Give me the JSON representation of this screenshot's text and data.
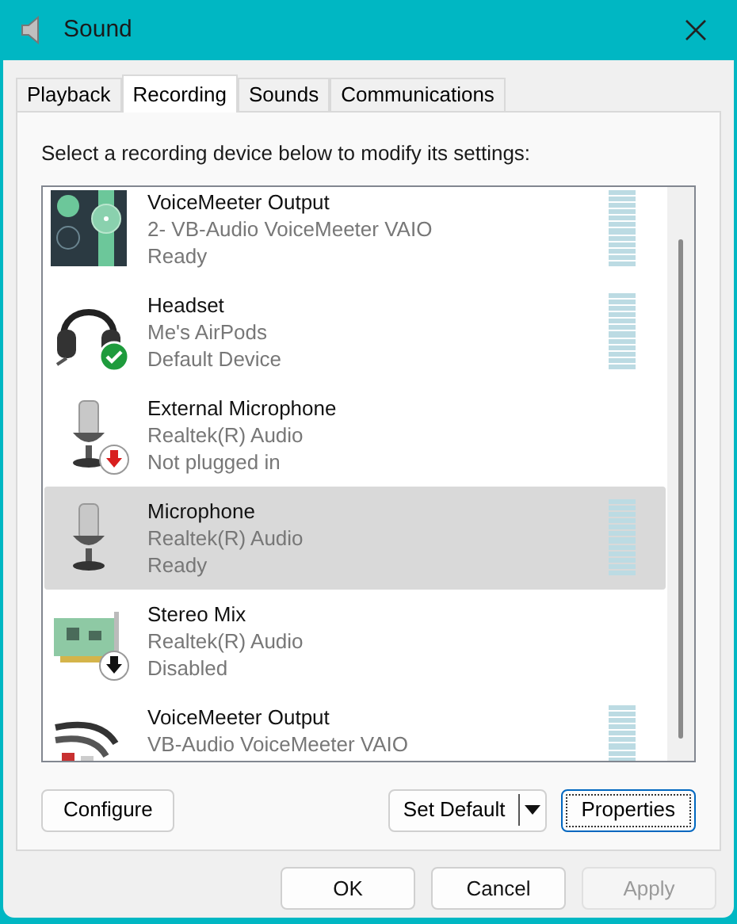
{
  "window": {
    "title": "Sound"
  },
  "tabs": [
    {
      "label": "Playback",
      "selected": false
    },
    {
      "label": "Recording",
      "selected": true
    },
    {
      "label": "Sounds",
      "selected": false
    },
    {
      "label": "Communications",
      "selected": false
    }
  ],
  "instruction": "Select a recording device below to modify its settings:",
  "devices": [
    {
      "kind": "mixer",
      "name": "VoiceMeeter Output",
      "detail": "2- VB-Audio VoiceMeeter VAIO",
      "status": "Ready",
      "default": false,
      "unplugged": false,
      "disabled": false,
      "meter": true,
      "selected": false
    },
    {
      "kind": "headset",
      "name": "Headset",
      "detail": "Me's AirPods",
      "status": "Default Device",
      "default": true,
      "unplugged": false,
      "disabled": false,
      "meter": true,
      "selected": false
    },
    {
      "kind": "microphone",
      "name": "External Microphone",
      "detail": "Realtek(R) Audio",
      "status": "Not plugged in",
      "default": false,
      "unplugged": true,
      "disabled": false,
      "meter": false,
      "selected": false
    },
    {
      "kind": "microphone",
      "name": "Microphone",
      "detail": "Realtek(R) Audio",
      "status": "Ready",
      "default": false,
      "unplugged": false,
      "disabled": false,
      "meter": true,
      "selected": true
    },
    {
      "kind": "card",
      "name": "Stereo Mix",
      "detail": "Realtek(R) Audio",
      "status": "Disabled",
      "default": false,
      "unplugged": false,
      "disabled": true,
      "meter": false,
      "selected": false
    },
    {
      "kind": "cable",
      "name": "VoiceMeeter Output",
      "detail": "VB-Audio VoiceMeeter VAIO",
      "default": false,
      "unplugged": false,
      "disabled": false,
      "meter": true,
      "selected": false
    }
  ],
  "panel_buttons": {
    "configure": "Configure",
    "set_default": "Set Default",
    "properties": "Properties"
  },
  "dialog_buttons": [
    {
      "label": "OK",
      "disabled": false
    },
    {
      "label": "Cancel",
      "disabled": false
    },
    {
      "label": "Apply",
      "disabled": true
    }
  ]
}
